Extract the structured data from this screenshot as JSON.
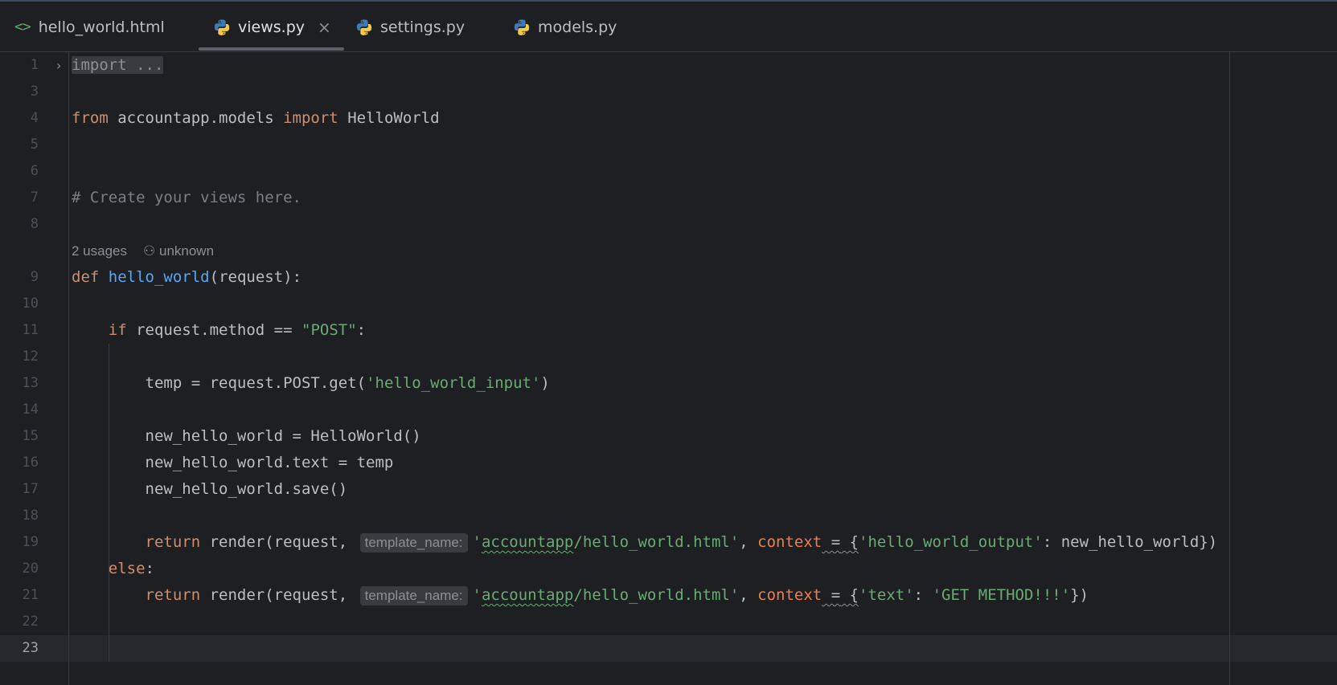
{
  "tabs": [
    {
      "label": "hello_world.html",
      "icon": "html-icon"
    },
    {
      "label": "views.py",
      "icon": "python-icon",
      "active": true
    },
    {
      "label": "settings.py",
      "icon": "python-icon"
    },
    {
      "label": "models.py",
      "icon": "python-icon"
    }
  ],
  "close_glyph": "×",
  "html_icon_glyph": "<>",
  "fold_glyph": "›",
  "lines": [
    "1",
    "3",
    "4",
    "5",
    "6",
    "7",
    "8",
    "9",
    "10",
    "11",
    "12",
    "13",
    "14",
    "15",
    "16",
    "17",
    "18",
    "19",
    "20",
    "21",
    "22",
    "23"
  ],
  "code": {
    "import_fold": "import ...",
    "l4_from": "from",
    "l4_module": " accountapp.models ",
    "l4_import": "import",
    "l4_name": " HelloWorld",
    "l7_comment": "# Create your views here.",
    "lens_usages": "2 usages",
    "lens_author": "unknown",
    "l9_def": "def",
    "l9_fn": "hello_world",
    "l9_args": "(request):",
    "l11_if": "if",
    "l11_cond": " request.method == ",
    "l11_str": "\"POST\"",
    "l11_colon": ":",
    "l13_code": "temp = request.POST.get(",
    "l13_str": "'hello_world_input'",
    "l13_close": ")",
    "l15": "new_hello_world = HelloWorld()",
    "l16": "new_hello_world.text = temp",
    "l17": "new_hello_world.save()",
    "ret_kw": "return",
    "ret_call": " render(request, ",
    "hint_template": "template_name:",
    "str_q": "'",
    "str_pkg": "accountapp",
    "str_rest": "/hello_world.html'",
    "comma": ", ",
    "param_context": "context",
    "eq_a": " =",
    "eq_b": " {",
    "l19_key": "'hello_world_output'",
    "l19_val": ": new_hello_world})",
    "l20_else": "else",
    "l20_colon": ":",
    "l21_key": "'text'",
    "l21_colon": ": ",
    "l21_val": "'GET METHOD!!!'",
    "l21_close": "})"
  },
  "colors": {
    "background": "#1e1f22",
    "keyword": "#cf8e6d",
    "function": "#56a8f5",
    "string": "#6aab73",
    "comment": "#7a7e85",
    "parameter": "#ee7f4d"
  }
}
